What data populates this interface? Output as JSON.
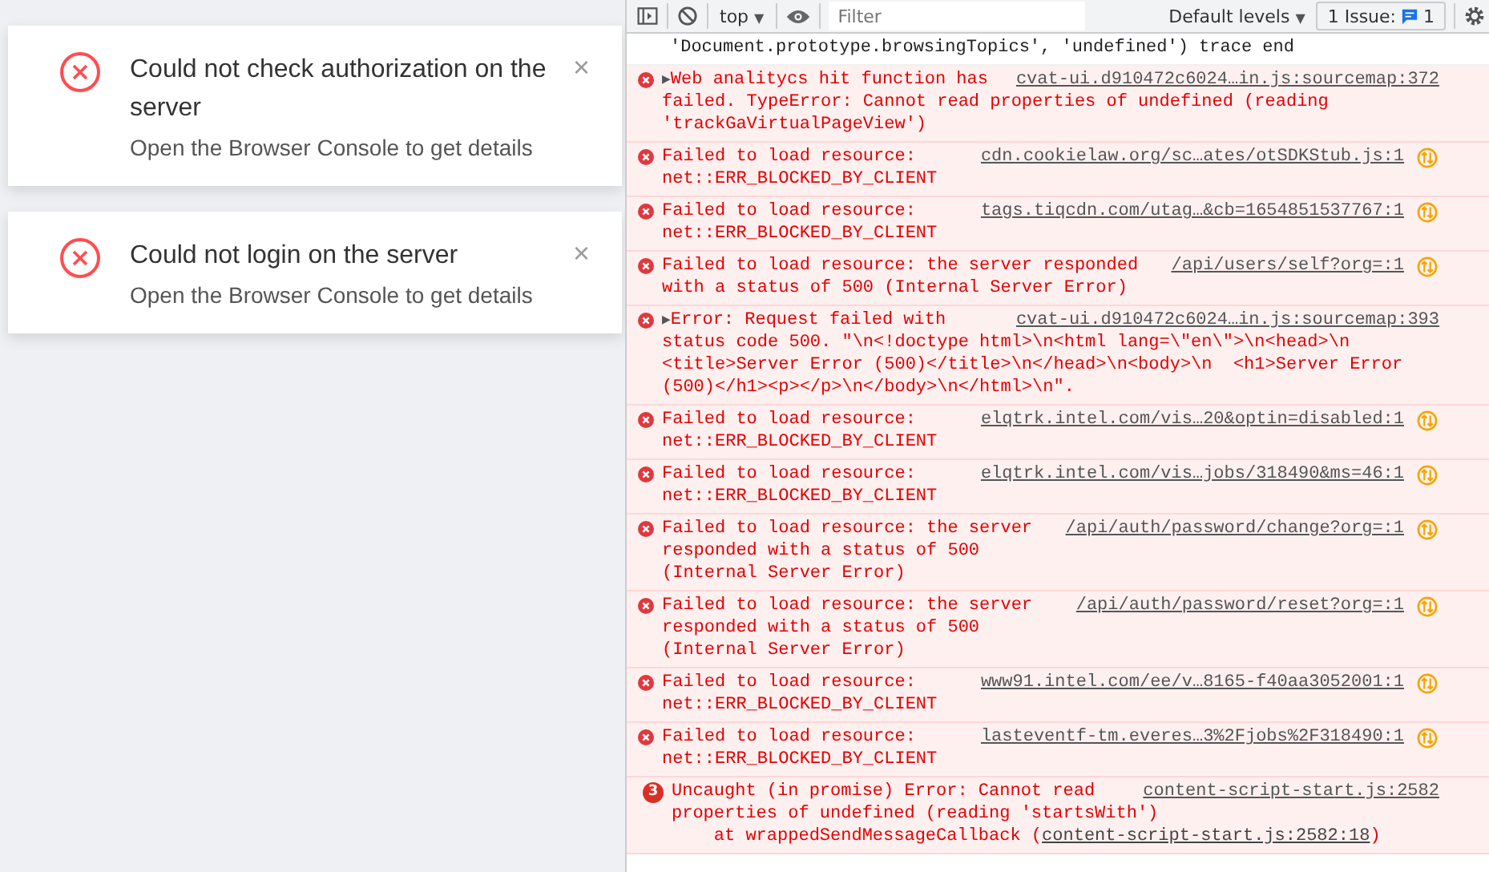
{
  "notifications": [
    {
      "title": "Could not check authorization on the server",
      "description": "Open the Browser Console to get details",
      "close": "×"
    },
    {
      "title": "Could not login on the server",
      "description": "Open the Browser Console to get details",
      "close": "×"
    }
  ],
  "toolbar": {
    "context": "top",
    "context_caret": "▼",
    "filter": {
      "placeholder": "Filter"
    },
    "levels": "Default levels",
    "levels_caret": "▼",
    "issues_label": "1 Issue:",
    "issues_count": "1"
  },
  "messages": [
    {
      "kind": "log",
      "lines": [
        "'Document.prototype.browsingTopics', 'undefined') trace end"
      ]
    },
    {
      "kind": "error",
      "expander": "▶",
      "lines": [
        "Web analitycs hit function has",
        "failed. TypeError: Cannot read properties of undefined (reading",
        "'trackGaVirtualPageView')"
      ],
      "source": "cvat-ui.d910472c6024…in.js:sourcemap:372",
      "network_icon": false
    },
    {
      "kind": "error",
      "lines": [
        "Failed to load resource:",
        "net::ERR_BLOCKED_BY_CLIENT"
      ],
      "source": "cdn.cookielaw.org/sc…ates/otSDKStub.js:1",
      "network_icon": true
    },
    {
      "kind": "error",
      "lines": [
        "Failed to load resource:",
        "net::ERR_BLOCKED_BY_CLIENT"
      ],
      "source": "tags.tiqcdn.com/utag…&cb=1654851537767:1",
      "network_icon": true
    },
    {
      "kind": "error",
      "lines": [
        "Failed to load resource: the server responded",
        "with a status of 500 (Internal Server Error)"
      ],
      "source": "/api/users/self?org=:1",
      "network_icon": true
    },
    {
      "kind": "error",
      "expander": "▶",
      "lines": [
        "Error: Request failed with",
        "status code 500. \"\\n<!doctype html>\\n<html lang=\\\"en\\\">\\n<head>\\n",
        "<title>Server Error (500)</title>\\n</head>\\n<body>\\n  <h1>Server Error",
        "(500)</h1><p></p>\\n</body>\\n</html>\\n\"."
      ],
      "source": "cvat-ui.d910472c6024…in.js:sourcemap:393",
      "network_icon": false
    },
    {
      "kind": "error",
      "lines": [
        "Failed to load resource:",
        "net::ERR_BLOCKED_BY_CLIENT"
      ],
      "source": "elqtrk.intel.com/vis…20&optin=disabled:1",
      "network_icon": true
    },
    {
      "kind": "error",
      "lines": [
        "Failed to load resource:",
        "net::ERR_BLOCKED_BY_CLIENT"
      ],
      "source": "elqtrk.intel.com/vis…jobs/318490&ms=46:1",
      "network_icon": true
    },
    {
      "kind": "error",
      "lines": [
        "Failed to load resource: the server",
        "responded with a status of 500",
        "(Internal Server Error)"
      ],
      "source": "/api/auth/password/change?org=:1",
      "network_icon": true
    },
    {
      "kind": "error",
      "lines": [
        "Failed to load resource: the server",
        "responded with a status of 500",
        "(Internal Server Error)"
      ],
      "source": "/api/auth/password/reset?org=:1",
      "network_icon": true
    },
    {
      "kind": "error",
      "lines": [
        "Failed to load resource:",
        "net::ERR_BLOCKED_BY_CLIENT"
      ],
      "source": "www91.intel.com/ee/v…8165-f40aa3052001:1",
      "network_icon": true
    },
    {
      "kind": "error",
      "lines": [
        "Failed to load resource:",
        "net::ERR_BLOCKED_BY_CLIENT"
      ],
      "source": "lasteventf-tm.everes…3%2Fjobs%2F318490:1",
      "network_icon": true
    },
    {
      "kind": "error",
      "count": "3",
      "lines": [
        "Uncaught (in promise) Error: Cannot read",
        "properties of undefined (reading 'startsWith')"
      ],
      "source": "content-script-start.js:2582",
      "network_icon": false,
      "stack": {
        "prefix": "    at wrappedSendMessageCallback (",
        "link": "content-script-start.js:2582:18",
        "suffix": ")"
      }
    }
  ]
}
